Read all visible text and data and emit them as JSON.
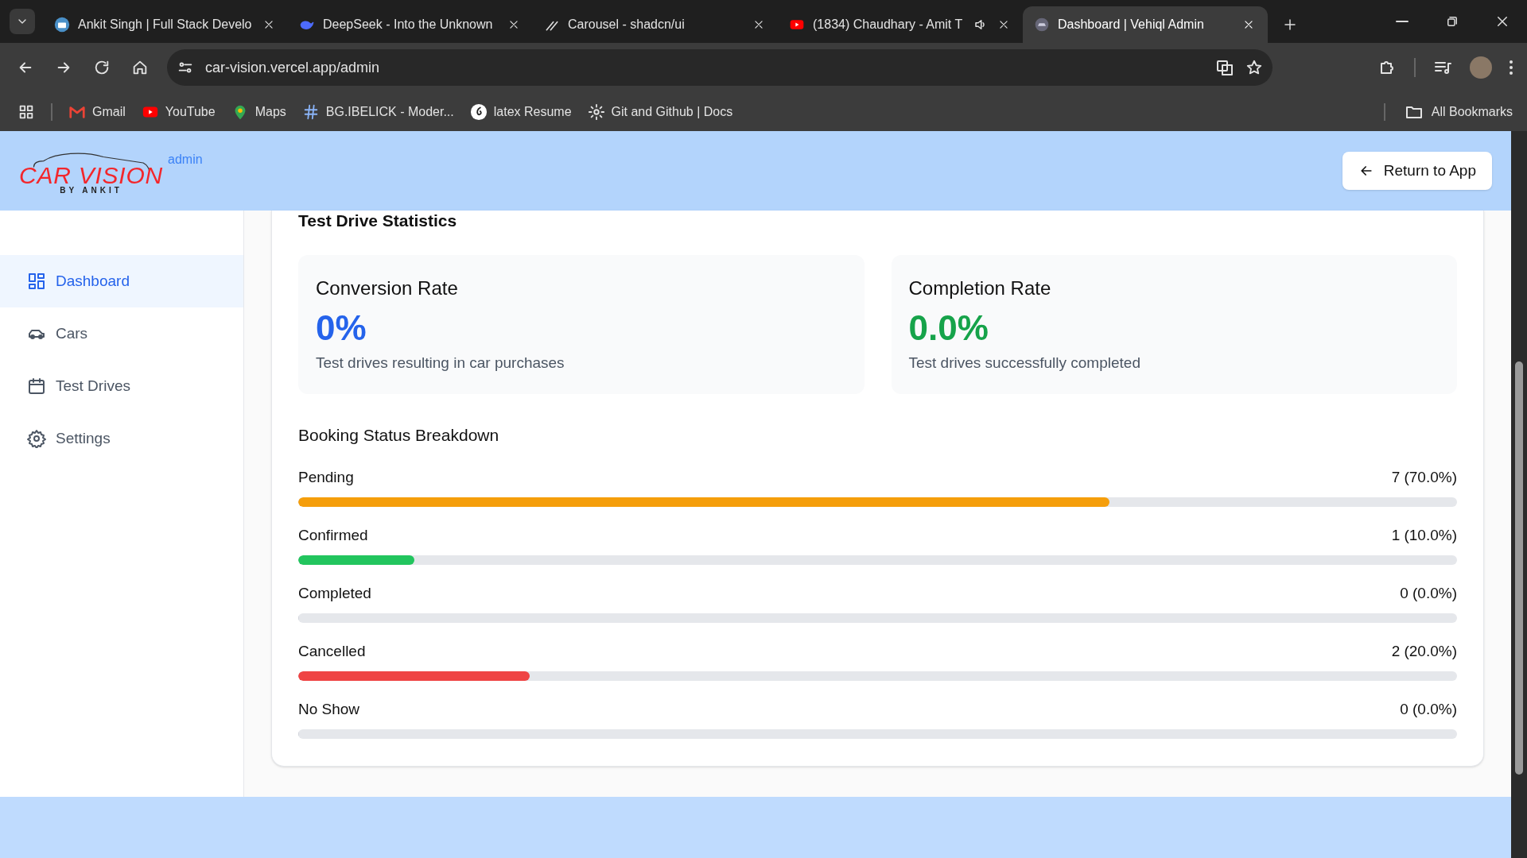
{
  "browser": {
    "tabs": [
      {
        "title": "Ankit Singh | Full Stack Develo",
        "selected": false,
        "audio": false
      },
      {
        "title": "DeepSeek - Into the Unknown",
        "selected": false,
        "audio": false
      },
      {
        "title": "Carousel - shadcn/ui",
        "selected": false,
        "audio": false
      },
      {
        "title": "(1834) Chaudhary - Amit T",
        "selected": false,
        "audio": true
      },
      {
        "title": "Dashboard | Vehiql Admin",
        "selected": true,
        "audio": false
      }
    ],
    "url": "car-vision.vercel.app/admin",
    "bookmarks": [
      {
        "label": "Gmail"
      },
      {
        "label": "YouTube"
      },
      {
        "label": "Maps"
      },
      {
        "label": "BG.IBELICK - Moder..."
      },
      {
        "label": "latex Resume"
      },
      {
        "label": "Git and Github | Docs"
      }
    ],
    "all_bookmarks": "All Bookmarks"
  },
  "header": {
    "logo": {
      "title": "CAR VISION",
      "subtitle": "BY ANKIT"
    },
    "badge": "admin",
    "return_button": "Return to App"
  },
  "sidebar": {
    "items": [
      {
        "label": "Dashboard",
        "selected": true
      },
      {
        "label": "Cars",
        "selected": false
      },
      {
        "label": "Test Drives",
        "selected": false
      },
      {
        "label": "Settings",
        "selected": false
      }
    ]
  },
  "stats": {
    "title": "Test Drive Statistics",
    "cards": [
      {
        "title": "Conversion Rate",
        "value": "0%",
        "caption": "Test drives resulting in car purchases",
        "color": "#2563eb"
      },
      {
        "title": "Completion Rate",
        "value": "0.0%",
        "caption": "Test drives successfully completed",
        "color": "#16a34a"
      }
    ],
    "breakdown_title": "Booking Status Breakdown",
    "statuses": [
      {
        "label": "Pending",
        "reading": "7 (70.0%)",
        "level": 0.7,
        "color": "#f59e0b"
      },
      {
        "label": "Confirmed",
        "reading": "1 (10.0%)",
        "level": 0.1,
        "color": "#22c55e"
      },
      {
        "label": "Completed",
        "reading": "0 (0.0%)",
        "level": 0
      },
      {
        "label": "Cancelled",
        "reading": "2 (20.0%)",
        "level": 0.2,
        "color": "#ef4444"
      },
      {
        "label": "No Show",
        "reading": "0 (0.0%)",
        "level": 0
      }
    ]
  }
}
